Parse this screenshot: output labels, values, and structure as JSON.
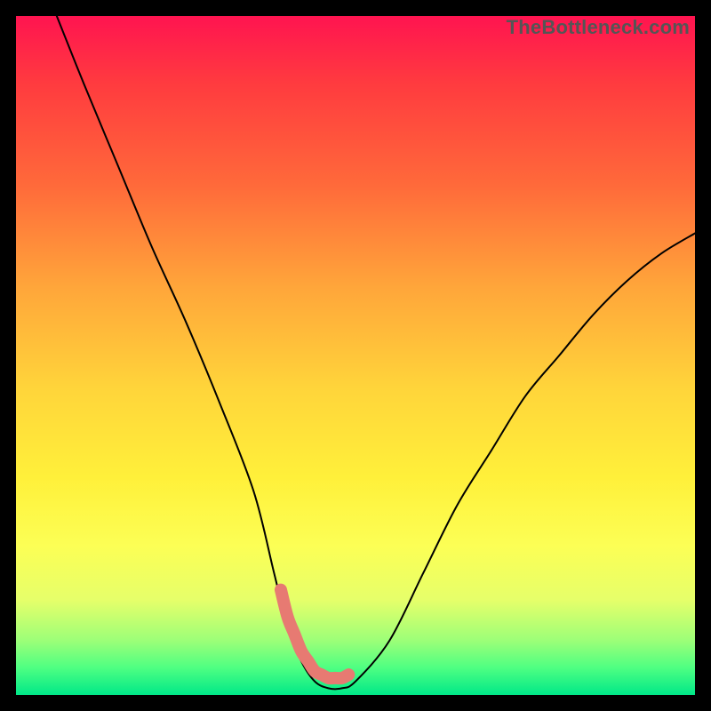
{
  "watermark": "TheBottleneck.com",
  "chart_data": {
    "type": "line",
    "title": "",
    "xlabel": "",
    "ylabel": "",
    "xlim": [
      0,
      100
    ],
    "ylim": [
      0,
      100
    ],
    "series": [
      {
        "name": "bottleneck-curve",
        "x": [
          6,
          10,
          15,
          20,
          25,
          30,
          35,
          38,
          40,
          42,
          44,
          46,
          48,
          50,
          55,
          60,
          65,
          70,
          75,
          80,
          85,
          90,
          95,
          100
        ],
        "values": [
          100,
          90,
          78,
          66,
          55,
          43,
          30,
          18,
          10,
          5,
          2,
          1,
          1,
          2,
          8,
          18,
          28,
          36,
          44,
          50,
          56,
          61,
          65,
          68
        ]
      }
    ],
    "annotations": [
      {
        "name": "trough-highlight",
        "type": "segment",
        "color": "#e77a72",
        "x": [
          39,
          49
        ],
        "values": [
          4.5,
          4.5
        ]
      }
    ]
  }
}
